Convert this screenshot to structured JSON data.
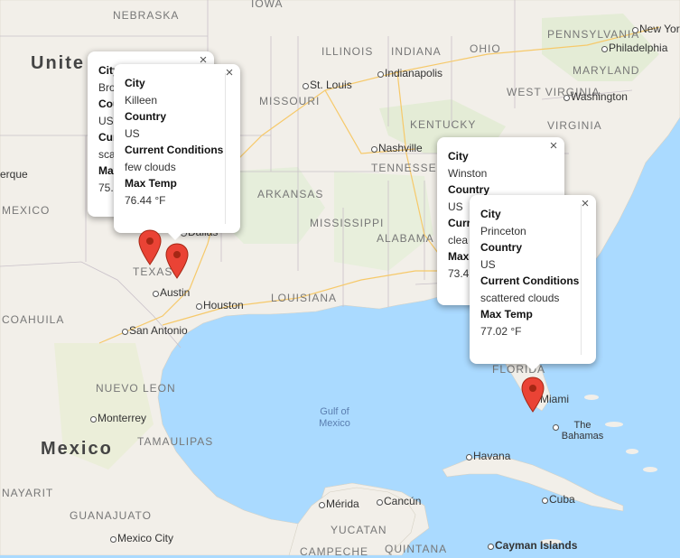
{
  "map": {
    "state_labels": [
      "NEBRASKA",
      "IOWA",
      "ILLINOIS",
      "INDIANA",
      "OHIO",
      "PENNSYLVANIA",
      "MISSOURI",
      "KENTUCKY",
      "WEST VIRGINIA",
      "VIRGINIA",
      "MARYLAND",
      "TENNESSEE",
      "ARKANSAS",
      "MISSISSIPPI",
      "ALABAMA",
      "TEXAS",
      "LOUISIANA",
      "FLORIDA",
      "COAHUILA",
      "NUEVO LEON",
      "TAMAULIPAS",
      "NAYARIT",
      "GUANAJUATO",
      "YUCATAN",
      "QUINTANA",
      "CAMPECHE",
      "MEXICO"
    ],
    "city_labels": [
      "New York",
      "Philadelphia",
      "Washington",
      "Indianapolis",
      "St. Louis",
      "Nashville",
      "Austin",
      "Houston",
      "San Antonio",
      "Monterrey",
      "Havana",
      "Cuba",
      "Mérida",
      "Cancún",
      "Mexico City",
      "Cayman Islands",
      "Miami",
      "The Bahamas",
      "Dallas",
      "erque"
    ],
    "country_labels": [
      "Unite",
      "Mexico"
    ],
    "water_labels": [
      "Gulf of Mexico"
    ]
  },
  "popups": [
    {
      "id": "back-popup",
      "fields": [
        {
          "key": "City",
          "value": "Bro"
        },
        {
          "key": "Country",
          "value": "US"
        },
        {
          "key": "Current Conditions",
          "value": "sca"
        },
        {
          "key": "Max Temp",
          "value": "75."
        }
      ]
    },
    {
      "id": "killeen-popup",
      "fields": [
        {
          "key": "City",
          "value": "Killeen"
        },
        {
          "key": "Country",
          "value": "US"
        },
        {
          "key": "Current Conditions",
          "value": "few clouds"
        },
        {
          "key": "Max Temp",
          "value": "76.44 °F"
        }
      ]
    },
    {
      "id": "winston-popup",
      "fields": [
        {
          "key": "City",
          "value": "Winston"
        },
        {
          "key": "Country",
          "value": "US"
        },
        {
          "key": "Current Conditions",
          "value": "clea"
        },
        {
          "key": "Max Temp",
          "value": "73.4"
        }
      ]
    },
    {
      "id": "princeton-popup",
      "fields": [
        {
          "key": "City",
          "value": "Princeton"
        },
        {
          "key": "Country",
          "value": "US"
        },
        {
          "key": "Current Conditions",
          "value": "scattered clouds"
        },
        {
          "key": "Max Temp",
          "value": "77.02 °F"
        }
      ]
    }
  ],
  "close_glyph": "×",
  "colors": {
    "water": "#aadaff",
    "land": "#f2efe9",
    "land_green": "#e4ecd6",
    "marker": "#ea4335",
    "marker_dark": "#a52714"
  }
}
